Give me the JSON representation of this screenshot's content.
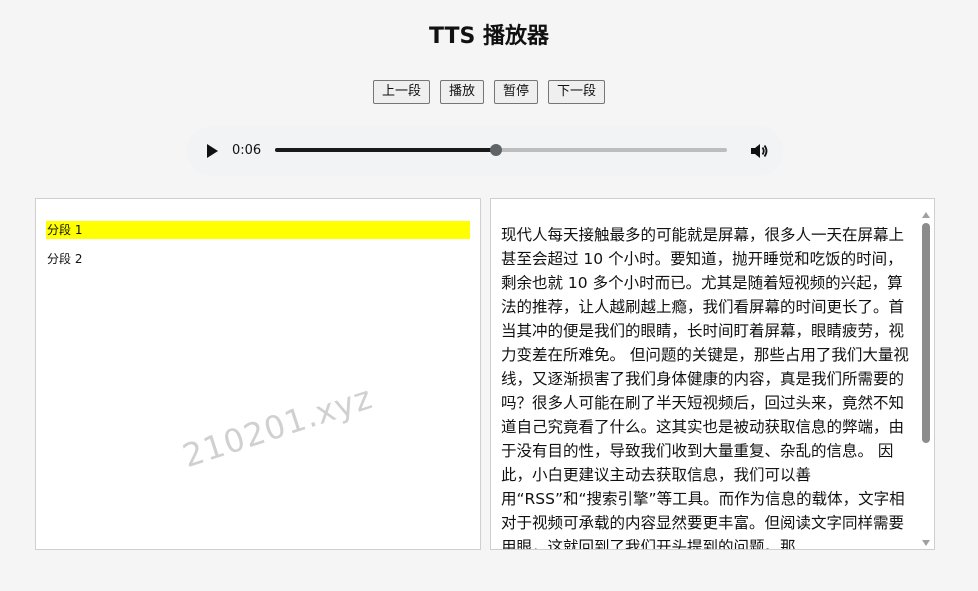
{
  "title": "TTS 播放器",
  "controls": {
    "prev_label": "上一段",
    "play_label": "播放",
    "pause_label": "暂停",
    "next_label": "下一段"
  },
  "audio": {
    "current_time": "0:06",
    "progress": 0.49,
    "play_icon": "play-icon",
    "volume_icon": "volume-icon"
  },
  "segments": [
    {
      "label": "分段 1",
      "active": true
    },
    {
      "label": "分段 2",
      "active": false
    }
  ],
  "watermark": "210201.xyz",
  "content": {
    "text": "现代人每天接触最多的可能就是屏幕，很多人一天在屏幕上甚至会超过 10 个小时。要知道，抛开睡觉和吃饭的时间，剩余也就 10 多个小时而已。尤其是随着短视频的兴起，算法的推荐，让人越刷越上瘾，我们看屏幕的时间更长了。首当其冲的便是我们的眼睛，长时间盯着屏幕，眼睛疲劳，视力变差在所难免。 但问题的关键是，那些占用了我们大量视线，又逐渐损害了我们身体健康的内容，真是我们所需要的吗？很多人可能在刷了半天短视频后，回过头来，竟然不知道自己究竟看了什么。这其实也是被动获取信息的弊端，由于没有目的性，导致我们收到大量重复、杂乱的信息。 因此，小白更建议主动去获取信息，我们可以善用“RSS”和“搜索引擎”等工具。而作为信息的载体，文字相对于视频可承载的内容显然要更丰富。但阅读文字同样需要用眼，这就回到了我们开头提到的问题。那"
  },
  "colors": {
    "highlight": "#ffff00",
    "scroll_thumb": "#8c8c8c"
  }
}
